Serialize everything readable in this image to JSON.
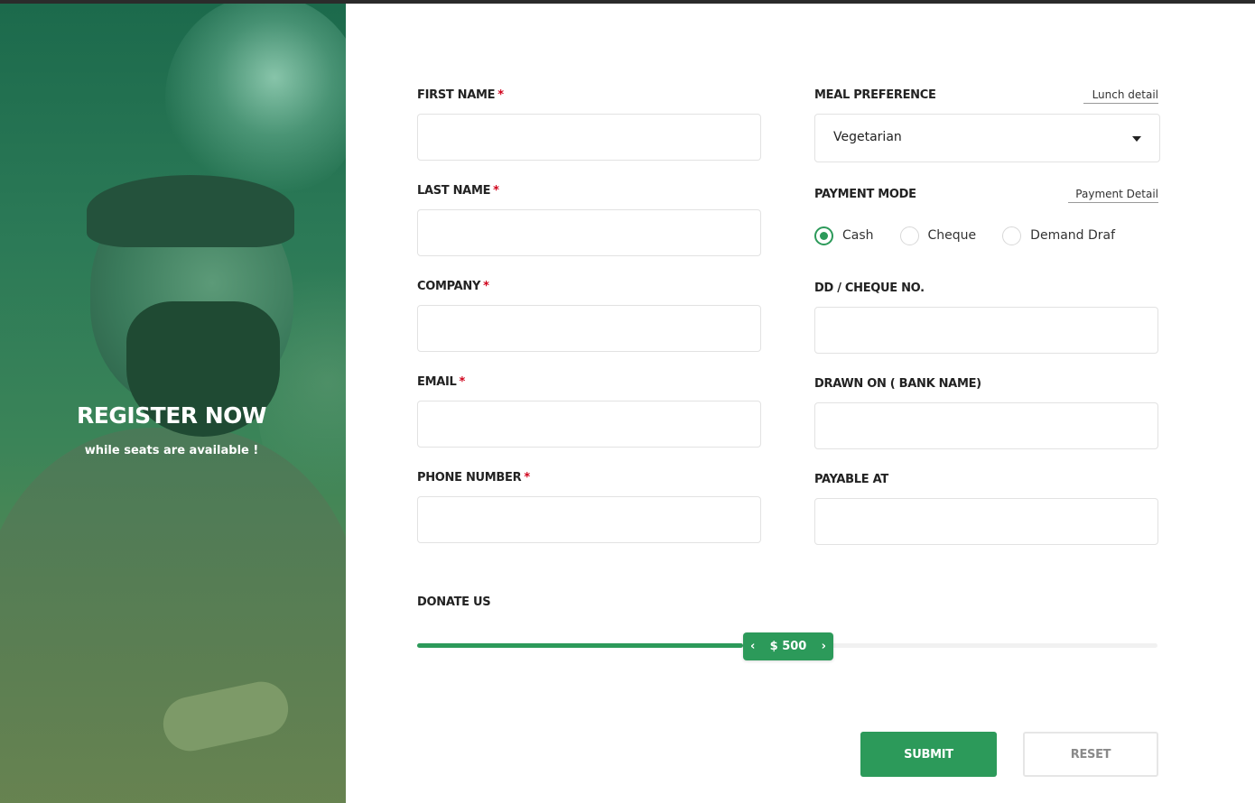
{
  "hero": {
    "headline": "REGISTER NOW",
    "subline": "while seats are available !"
  },
  "form": {
    "first_name": {
      "label": "FIRST NAME",
      "required": "*",
      "value": ""
    },
    "last_name": {
      "label": "LAST NAME",
      "required": "*",
      "value": ""
    },
    "company": {
      "label": "COMPANY",
      "required": "*",
      "value": ""
    },
    "email": {
      "label": "EMAIL",
      "required": "*",
      "value": ""
    },
    "phone": {
      "label": "PHONE NUMBER",
      "required": "*",
      "value": ""
    },
    "meal": {
      "label": "MEAL PREFERENCE",
      "link": "Lunch detail",
      "selected": "Vegetarian"
    },
    "payment": {
      "label": "PAYMENT MODE",
      "link": "Payment Detail",
      "options": [
        "Cash",
        "Cheque",
        "Demand Draf"
      ],
      "selected": "Cash"
    },
    "cheque_no": {
      "label": "DD / CHEQUE NO.",
      "value": ""
    },
    "bank_name": {
      "label": "DRAWN ON ( BANK NAME)",
      "value": ""
    },
    "payable_at": {
      "label": "PAYABLE AT",
      "value": ""
    },
    "donate": {
      "label": "DONATE US",
      "amount": "$ 500",
      "prev_icon": "chevron-left-icon",
      "next_icon": "chevron-right-icon",
      "level_fraction": 0.44
    },
    "submit_label": "SUBMIT",
    "reset_label": "RESET"
  },
  "colors": {
    "accent": "#2c9a5a",
    "required": "#d0021b",
    "hero_top": "#1c6a4c",
    "hero_bottom": "#6e8b4b"
  }
}
